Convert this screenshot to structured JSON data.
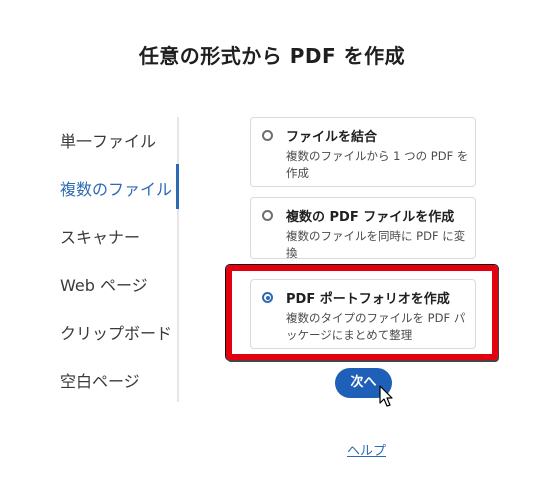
{
  "dialog": {
    "title": "任意の形式から PDF を作成"
  },
  "sidebar": {
    "items": [
      {
        "label": "単一ファイル"
      },
      {
        "label": "複数のファイル"
      },
      {
        "label": "スキャナー"
      },
      {
        "label": "Web ページ"
      },
      {
        "label": "クリップボード"
      },
      {
        "label": "空白ページ"
      }
    ],
    "selected": "複数のファイル"
  },
  "options": [
    {
      "title": "ファイルを結合",
      "description": "複数のファイルから 1 つの PDF を作成",
      "selected": false
    },
    {
      "title": "複数の PDF ファイルを作成",
      "description": "複数のファイルを同時に PDF に変換",
      "selected": false
    },
    {
      "title": "PDF ポートフォリオを作成",
      "description": "複数のタイプのファイルを PDF パッケージにまとめて整理",
      "selected": true
    }
  ],
  "actions": {
    "next_label": "次へ",
    "help_label": "ヘルプ"
  },
  "colors": {
    "accent": "#2e6ab3",
    "highlight_box": "#e3000f",
    "button": "#1e60b8"
  }
}
